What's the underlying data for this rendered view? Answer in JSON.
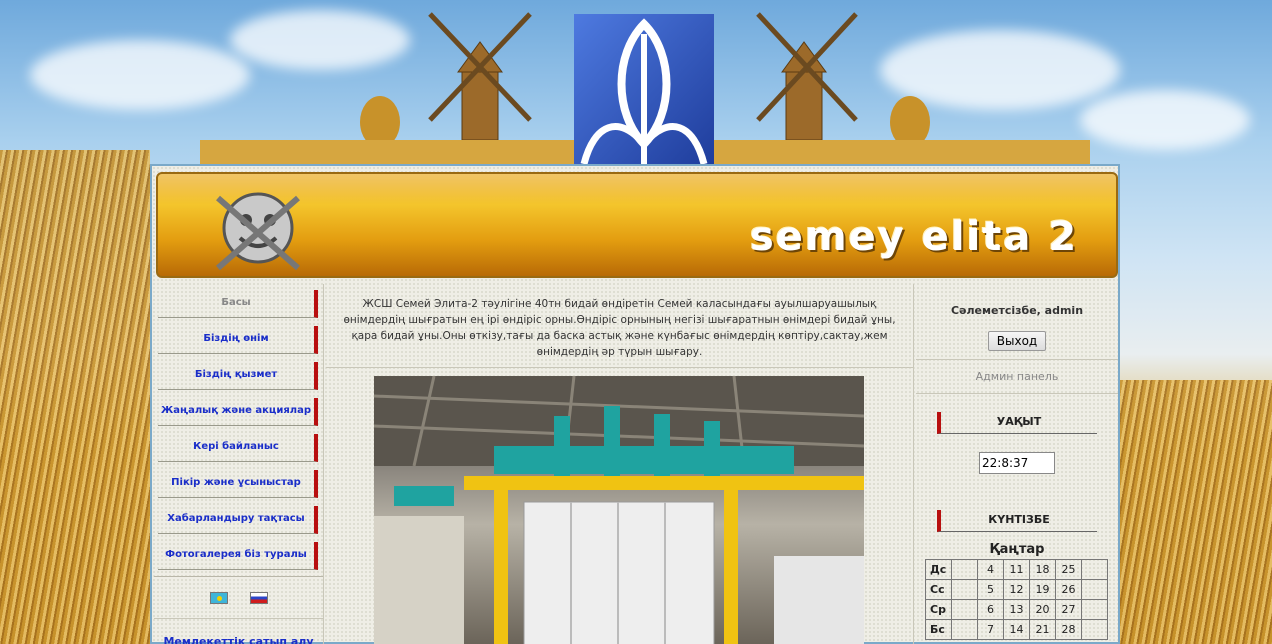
{
  "banner": {
    "title": "semey elita 2"
  },
  "nav": {
    "items": [
      {
        "label": "Басы",
        "active": true
      },
      {
        "label": "Біздің өнім"
      },
      {
        "label": "Біздің қызмет"
      },
      {
        "label": "Жаңалық және акциялар"
      },
      {
        "label": "Кері байланыс"
      },
      {
        "label": "Пікір және ұсыныстар"
      },
      {
        "label": "Хабарландыру тақтасы"
      },
      {
        "label": "Фотогалерея біз туралы"
      }
    ]
  },
  "languages": [
    "kz-flag-icon",
    "ru-flag-icon"
  ],
  "left": {
    "gov_link": "Мемлекеттік сатып алу"
  },
  "center": {
    "intro": "ЖСШ Семей Элита-2 тәулігіне 40тн бидай өндіретін Семей каласындағы ауылшаруашылық өнімдердің шығратын ең ірі өндіріс орны.Өндіріс орнының негізі шығаратнын өнімдері бидай ұны, қара бидай ұны.Оны өткізу,тағы да баска астық және күнбағыс өнімдердің көптіру,сактау,жем өнімдердің әр түрын шығару."
  },
  "right": {
    "greeting": "Сәлеметсізбе, admin",
    "logout_label": "Выход",
    "admin_link": "Админ панель",
    "time_title": "УАҚЫТ",
    "time_value": "22:8:37",
    "calendar_title": "КҮНТІЗБЕ",
    "calendar_month": "Қаңтар",
    "calendar_rows": [
      [
        "Дс",
        "",
        "4",
        "11",
        "18",
        "25",
        ""
      ],
      [
        "Сс",
        "",
        "5",
        "12",
        "19",
        "26",
        ""
      ],
      [
        "Ср",
        "",
        "6",
        "13",
        "20",
        "27",
        ""
      ],
      [
        "Бс",
        "",
        "7",
        "14",
        "21",
        "28",
        ""
      ]
    ]
  },
  "colors": {
    "nav_text": "#1a2ec9",
    "nav_marker": "#b80f0f",
    "banner": "#f4c52c"
  }
}
